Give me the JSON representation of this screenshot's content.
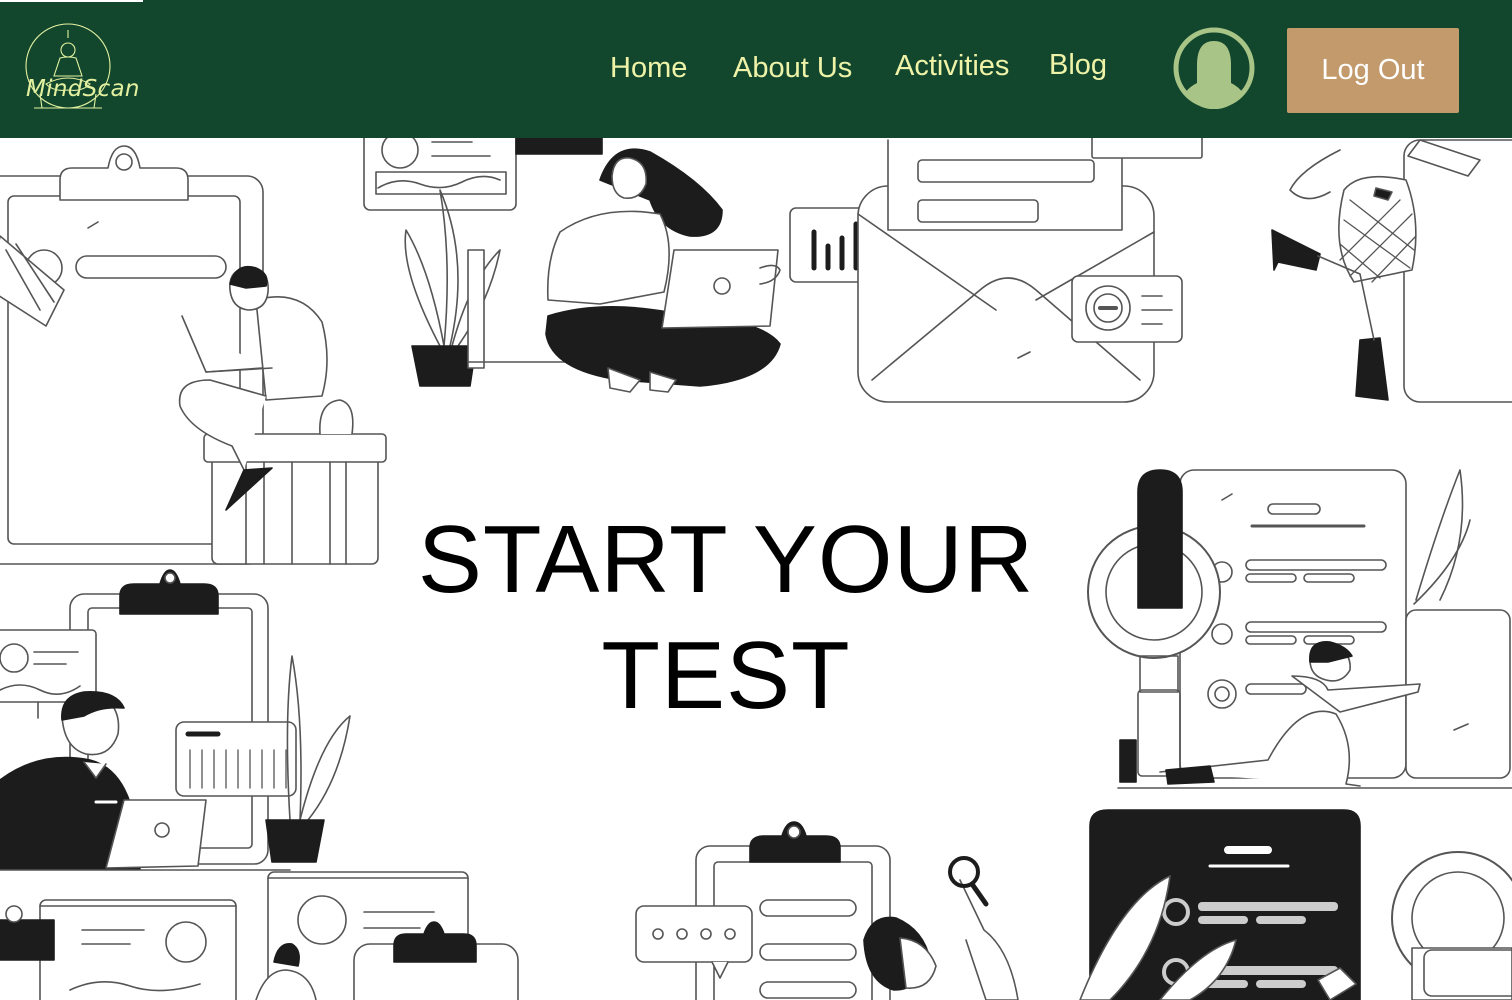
{
  "brand": {
    "name": "MindScan",
    "logo_icon": "meditation-figure-globe-icon"
  },
  "nav": {
    "links": [
      {
        "label": "Home"
      },
      {
        "label": "About Us"
      },
      {
        "label": "Activities"
      },
      {
        "label": "Blog"
      }
    ],
    "profile_icon": "user-avatar-icon",
    "logout_label": "Log Out"
  },
  "hero": {
    "title_line1": "START YOUR",
    "title_line2": "TEST"
  },
  "colors": {
    "navbar_bg": "#12472d",
    "nav_text": "#eef3a8",
    "logout_bg": "#c29a6b",
    "avatar_ring": "#a8c487"
  }
}
